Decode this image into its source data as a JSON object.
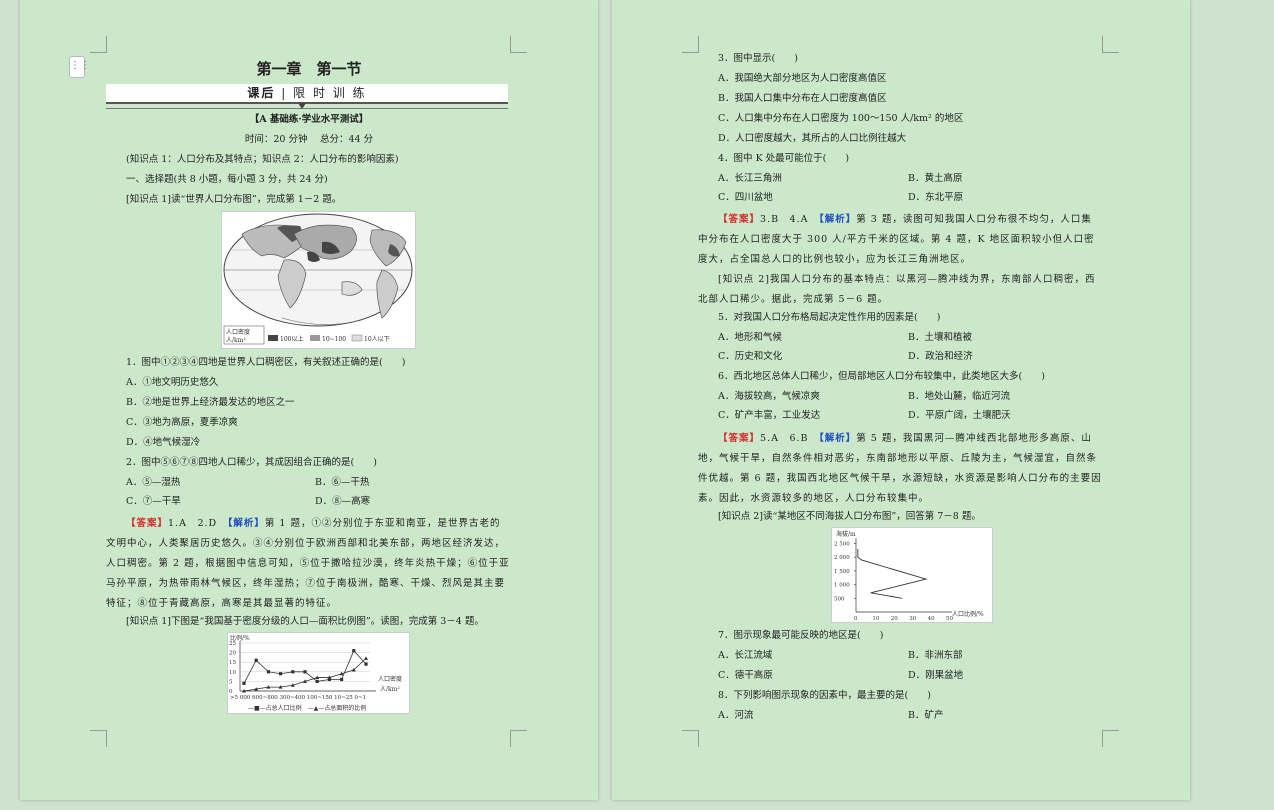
{
  "page1": {
    "title": "第一章　第一节",
    "banner_left": "课后",
    "banner_sep": "|",
    "banner_right": "限 时 训 练",
    "test_name": "【A 基础练·学业水平测试】",
    "time_score": "时间：20 分钟　 总分：44 分",
    "knowledge": "(知识点 1：人口分布及其特点；知识点 2：人口分布的影响因素)",
    "section": "一、选择题(共 8 小题，每小题 3 分，共 24 分)",
    "intro1": "[知识点 1]读“世界人口分布图”，完成第 1－2 题。",
    "map_legend": [
      "人口密度",
      "人/km²",
      "100以上",
      "10~100",
      "10人以下"
    ],
    "q1": "1．图中①②③④四地是世界人口稠密区，有关叙述正确的是(　　)",
    "q1_options": [
      "A．①地文明历史悠久",
      "B．②地是世界上经济最发达的地区之一",
      "C．③地为高原，夏季凉爽",
      "D．④地气候湿冷"
    ],
    "q2": "2．图中⑤⑥⑦⑧四地人口稀少，其成因组合正确的是(　　)",
    "q2_options": [
      "A．⑤—湿热",
      "B．⑥—干热",
      "C．⑦—干旱",
      "D．⑧—高寒"
    ],
    "ans1_label": "【答案】",
    "ans1_value": "1.A　2.D",
    "ans1_analysis": "【解析】",
    "ans1_text": "第 1 题，①②分别位于东亚和南亚，是世界古老的文明中心，人类聚居历史悠久。③④分别位于欧洲西部和北美东部，两地区经济发达，人口稠密。第 2 题，根据图中信息可知，⑤位于撒哈拉沙漠，终年炎热干燥；⑥位于亚马孙平原，为热带雨林气候区，终年湿热；⑦位于南极洲，酷寒、干燥、烈风是其主要特征；⑧位于青藏高原，高寒是其最显著的特征。",
    "intro2": "[知识点 1]下图是“我国基于密度分级的人口—面积比例图”。读图，完成第 3－4 题。",
    "chart_axis": "比例/%",
    "chart_unit": "人口密度",
    "chart_unit2": "人/km²",
    "chart_x_labels": ">5 000 600~800 300~400 100~150 10~25 0~1",
    "chart_legend": "—■—占总人口比例　—▲—占总面积的比例"
  },
  "page2": {
    "q3": "3．图中显示(　　)",
    "q3_options": [
      "A．我国绝大部分地区为人口密度高值区",
      "B．我国人口集中分布在人口密度高值区",
      "C．人口集中分布在人口密度为 100～150 人/km² 的地区",
      "D．人口密度越大，其所占的人口比例往越大"
    ],
    "q4": "4．图中 K 处最可能位于(　　)",
    "q4_options": [
      "A．长江三角洲",
      "B．黄土高原",
      "C．四川盆地",
      "D．东北平原"
    ],
    "ans2_label": "【答案】",
    "ans2_value": "3.B　4.A",
    "ans2_analysis": "【解析】",
    "ans2_text": "第 3 题，读图可知我国人口分布很不均匀，人口集中分布在人口密度大于 300 人/平方千米的区域。第 4 题，K 地区面积较小但人口密度大，占全国总人口的比例也较小，应为长江三角洲地区。",
    "intro3": "[知识点 2]我国人口分布的基本特点：以黑河—腾冲线为界，东南部人口稠密，西北部人口稀少。据此，完成第 5－6 题。",
    "q5": "5．对我国人口分布格局起决定性作用的因素是(　　)",
    "q5_options": [
      "A．地形和气候",
      "B．土壤和植被",
      "C．历史和文化",
      "D．政治和经济"
    ],
    "q6": "6．西北地区总体人口稀少，但局部地区人口分布较集中，此类地区大多(　　)",
    "q6_options": [
      "A．海拔较高，气候凉爽",
      "B．地处山麓，临近河流",
      "C．矿产丰富，工业发达",
      "D．平原广阔，土壤肥沃"
    ],
    "ans3_label": "【答案】",
    "ans3_value": "5.A　6.B",
    "ans3_analysis": "【解析】",
    "ans3_text": "第 5 题，我国黑河—腾冲线西北部地形多高原、山地，气候干旱，自然条件相对恶劣，东南部地形以平原、丘陵为主，气候湿宜，自然条件优越。第 6 题，我国西北地区气候干旱，水源短缺，水资源是影响人口分布的主要因素。因此，水资源较多的地区，人口分布较集中。",
    "intro4": "[知识点 2]读“某地区不同海拔人口分布图”，回答第 7－8 题。",
    "alt_axis": "海拔/m",
    "alt_ticks": [
      "2 500",
      "2 000",
      "1 500",
      "1 000",
      "500"
    ],
    "alt_x_ticks": [
      "0",
      "10",
      "20",
      "30",
      "40",
      "50"
    ],
    "alt_x_label": "人口比例/%",
    "q7": "7．图示现象最可能反映的地区是(　　)",
    "q7_options": [
      "A．长江流域",
      "B．非洲东部",
      "C．德干高原",
      "D．刚果盆地"
    ],
    "q8": "8．下列影响图示现象的因素中，最主要的是(　　)",
    "q8_options": [
      "A．河流",
      "B．矿产"
    ]
  },
  "chart_data": [
    {
      "type": "line",
      "categories": [
        ">5 000",
        "",
        "600~800",
        "",
        "300~400",
        "",
        "100~150",
        "",
        "10~25",
        "",
        "0~1"
      ],
      "xlabel": "人口密度 人/km²",
      "ylabel": "比例/%",
      "ylim": [
        0,
        25
      ],
      "series": [
        {
          "name": "占总人口比例",
          "values": [
            4,
            16,
            10,
            9,
            10,
            10,
            5,
            6,
            6,
            21,
            14
          ]
        },
        {
          "name": "占总面积的比例",
          "values": [
            0,
            1,
            2,
            2,
            3,
            5,
            7,
            7,
            9,
            11,
            17
          ]
        }
      ]
    },
    {
      "type": "line",
      "xlabel": "人口比例/%",
      "ylabel": "海拔/m",
      "xlim": [
        0,
        50
      ],
      "ylim": [
        0,
        2700
      ],
      "series": [
        {
          "values": [
            [
              1,
              2300
            ],
            [
              1,
              2000
            ],
            [
              3,
              1900
            ],
            [
              38,
              1200
            ],
            [
              8,
              700
            ],
            [
              25,
              500
            ]
          ]
        }
      ]
    }
  ]
}
